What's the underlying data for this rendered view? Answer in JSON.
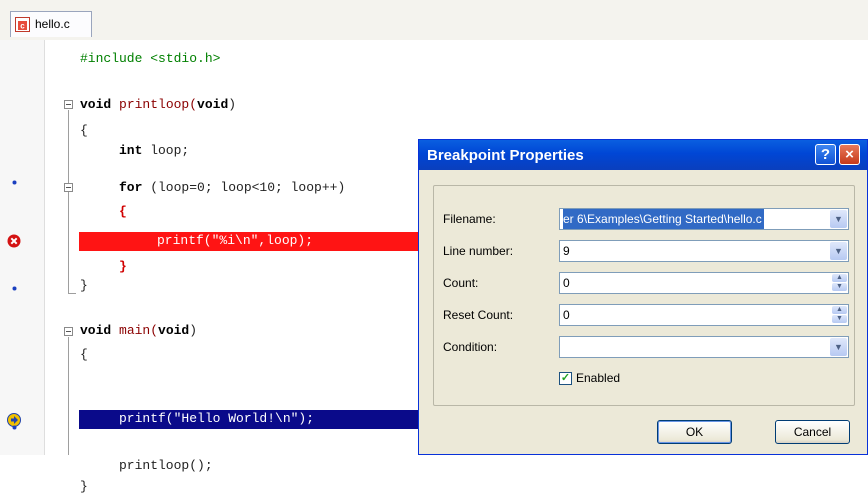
{
  "tab": {
    "label": "hello.c",
    "icon": "c-source-file-icon"
  },
  "code": [
    "#include <stdio.h>",
    "void",
    " printloop(",
    "void",
    ")",
    "{",
    "int",
    " loop;",
    "for",
    " (loop=0; loop<10; loop++)",
    "{",
    "printf(\"%i\\n\",loop);",
    "}",
    "}",
    "void",
    " main(",
    "void",
    ")",
    "{",
    "printf(\"Hello World!\\n\");",
    "printloop();",
    "}"
  ],
  "dialog": {
    "title": "Breakpoint Properties",
    "help_label": "?",
    "close_label": "×",
    "fields": {
      "filename": {
        "label": "Filename:",
        "value": "er 6\\Examples\\Getting Started\\hello.c"
      },
      "line_number": {
        "label": "Line number:",
        "value": "9"
      },
      "count": {
        "label": "Count:",
        "value": "0"
      },
      "reset_count": {
        "label": "Reset Count:",
        "value": "0"
      },
      "condition": {
        "label": "Condition:",
        "value": ""
      }
    },
    "enabled": {
      "label": "Enabled",
      "checked": true
    },
    "ok_label": "OK",
    "cancel_label": "Cancel"
  },
  "colors": {
    "breakpoint_line": "#ff1414",
    "current_line": "#0a0a8a",
    "title_bar": "#0046d5"
  }
}
